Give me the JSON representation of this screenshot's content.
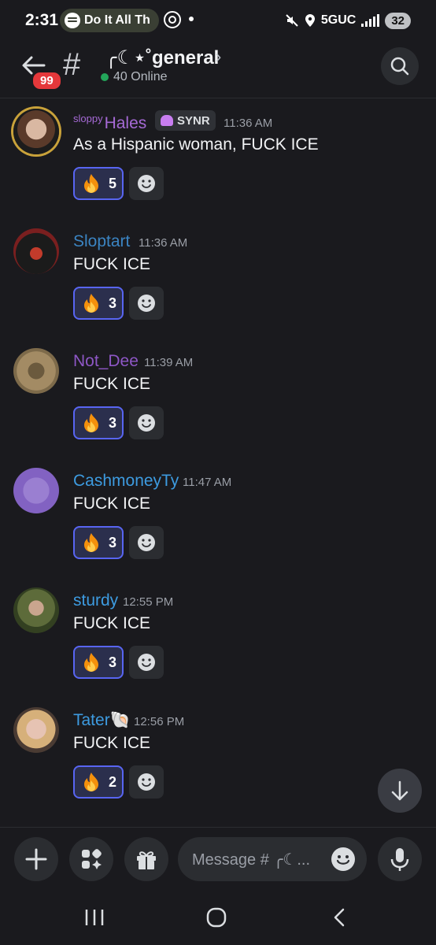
{
  "status_bar": {
    "time": "2:31",
    "media_pill": "Do It All Th",
    "network": "5GUC",
    "battery": "32"
  },
  "header": {
    "unread_badge": "99",
    "channel_prefix": "#",
    "channel_name": "╭☾⋆˚general",
    "chevron": "›",
    "online_text": "40 Online"
  },
  "messages": [
    {
      "name_prefix": "sloppy",
      "name": "Hales",
      "name_color": "#a66ad6",
      "tag": "SYNR",
      "time": "11:36 AM",
      "text": "As a Hispanic woman, FUCK ICE",
      "reaction_count": "5"
    },
    {
      "name_prefix": "",
      "name": "Sloptart",
      "name_color": "#3b84c2",
      "tag": "",
      "time": "11:36 AM",
      "text": "FUCK ICE",
      "reaction_count": "3"
    },
    {
      "name_prefix": "",
      "name": "Not_Dee",
      "name_color": "#8e57c6",
      "tag": "",
      "time": "11:39 AM",
      "text": "FUCK ICE",
      "reaction_count": "3"
    },
    {
      "name_prefix": "",
      "name": "CashmoneyTy",
      "name_color": "#3d9be0",
      "tag": "",
      "time": "11:47 AM",
      "text": "FUCK ICE",
      "reaction_count": "3"
    },
    {
      "name_prefix": "",
      "name": "sturdy",
      "name_color": "#3d9be0",
      "tag": "",
      "time": "12:55 PM",
      "text": "FUCK ICE",
      "reaction_count": "3"
    },
    {
      "name_prefix": "",
      "name": "Tater🐚",
      "name_color": "#3d9be0",
      "tag": "",
      "time": "12:56 PM",
      "text": "FUCK ICE",
      "reaction_count": "2"
    }
  ],
  "composer": {
    "placeholder": "Message # ╭☾..."
  },
  "colors": {
    "background": "#1a1a1e",
    "reaction_border": "#5865f2",
    "online": "#23a55a",
    "badge": "#e5383b"
  },
  "icons": [
    "back-arrow-icon",
    "hash-icon",
    "search-icon",
    "flame-emoji-icon",
    "add-reaction-icon",
    "scroll-down-icon",
    "plus-icon",
    "apps-icon",
    "gift-icon",
    "emoji-icon",
    "mic-icon",
    "recents-icon",
    "home-icon",
    "back-nav-icon"
  ]
}
